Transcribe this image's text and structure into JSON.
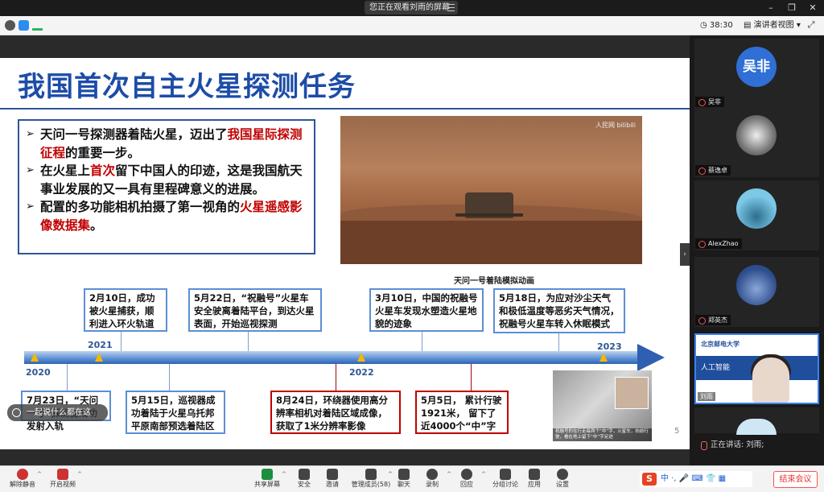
{
  "titlebar": {
    "share_status": "您正在观看刘雨的屏幕"
  },
  "toolbar": {
    "timer": "38:30",
    "view_mode": "演讲者视图"
  },
  "slide": {
    "title": "我国首次自主火星探测任务",
    "bullets": [
      {
        "pre": "天问一号探测器着陆火星，迈出了",
        "red": "我国星际探测征程",
        "post": "的重要一步。"
      },
      {
        "pre": "在火星上",
        "red": "首次",
        "post": "留下中国人的印迹，这是我国航天事业发展的又一具有里程碑意义的进展。"
      },
      {
        "pre": "配置的多功能相机拍摄了第一视角的",
        "red": "火星遥感影像数据集",
        "post": "。"
      }
    ],
    "photo_watermark": "人民网 bilibili",
    "photo_caption": "天问一号着陆模拟动画",
    "years": {
      "y2020": "2020",
      "y2021": "2021",
      "y2022": "2022",
      "y2023": "2023"
    },
    "events": {
      "feb10": "2月10日，成功被火星捕获，顺利进入环火轨道",
      "may22": "5月22日，“祝融号”火星车安全驶离着陆平台，到达火星表面，开始巡视探测",
      "mar10": "3月10日，中国的祝融号火星车发现水塑造火星地貌的迹象",
      "may18": "5月18日，为应对沙尘天气和极低温度等恶劣天气情况，祝融号火星车转入休眠模式",
      "jul23": "7月23日，“天问一号”探测器成功发射入轨",
      "may15": "5月15日，巡视器成功着陆于火星乌托邦平原南部预选着陆区",
      "aug24": "8月24日，环绕器使用高分辨率相机对着陆区域成像，获取了1米分辨率影像",
      "may5": "5月5日， 累计行驶1921米， 留下了近4000个“中”字"
    },
    "rover_caption": "祝融号的在行走每两个“中”字，火星车，向前行驶，看在地上留下“中”字足迹",
    "page_number": "5",
    "toast": "一起说什么都在这"
  },
  "participants": [
    {
      "name": "吴非",
      "avatar_text": "吴非",
      "color": "#2f6fd6"
    },
    {
      "name": "蔡逸卓",
      "avatar_text": "",
      "color": "#8a8a8a"
    },
    {
      "name": "AlexZhao",
      "avatar_text": "",
      "color": "#58b0d8"
    },
    {
      "name": "郑英杰",
      "avatar_text": "",
      "color": "#3a5c99"
    }
  ],
  "camera": {
    "name": "刘雨",
    "banner": "人工智能",
    "logo": "北京邮电大学"
  },
  "speaking": "正在讲话: 刘雨;",
  "bottombar": {
    "items": [
      "解除静音",
      "开启视频",
      "共享屏幕",
      "安全",
      "邀请",
      "管理成员(58)",
      "聊天",
      "录制",
      "回应",
      "分组讨论",
      "应用",
      "设置"
    ],
    "ime": "中 ·,",
    "end": "结束会议"
  }
}
